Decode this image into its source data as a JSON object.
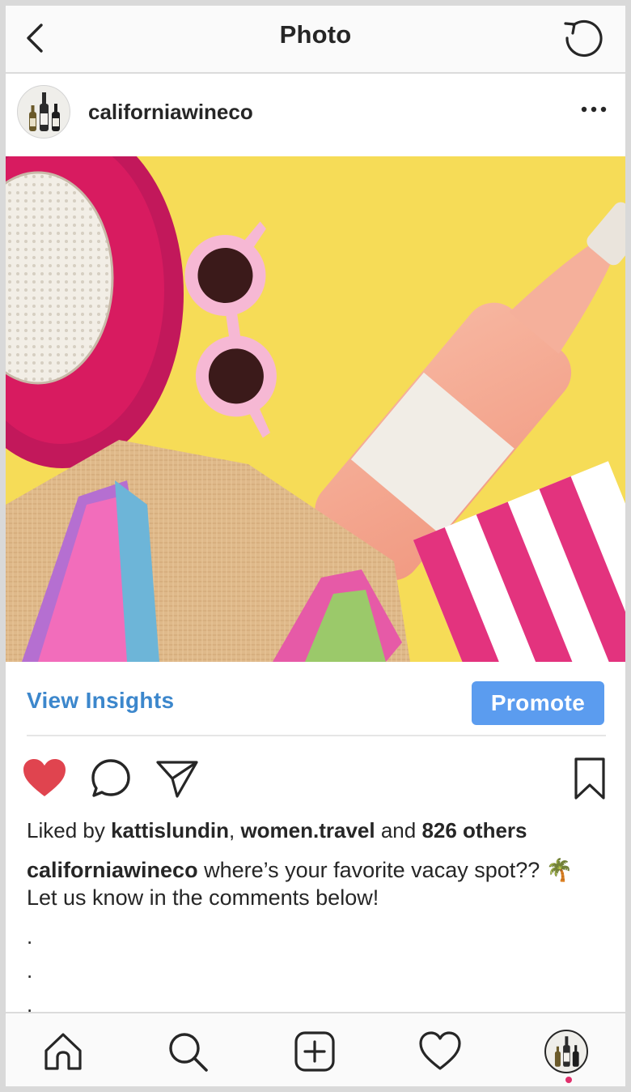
{
  "header": {
    "title": "Photo",
    "back_icon": "chevron-left-icon",
    "refresh_icon": "refresh-icon"
  },
  "post": {
    "username": "californiawineco",
    "more_icon": "more-horizontal-icon"
  },
  "insights": {
    "view_label": "View Insights",
    "promote_label": "Promote"
  },
  "actions": {
    "liked": true,
    "like_color": "#e0444f"
  },
  "likes": {
    "prefix": "Liked by ",
    "user1": "kattislundin",
    "sep": ", ",
    "user2": "women.travel",
    "and": " and ",
    "others": "826 others"
  },
  "caption": {
    "username": "californiawineco",
    "text": " where’s your favorite vacay spot?? 🌴 Let us know in the comments below!",
    "dots": [
      ".",
      ".",
      "."
    ]
  },
  "colors": {
    "accent": "#3c87cc",
    "promote_bg": "#5b9cef",
    "photo_bg": "#f6dc57"
  }
}
